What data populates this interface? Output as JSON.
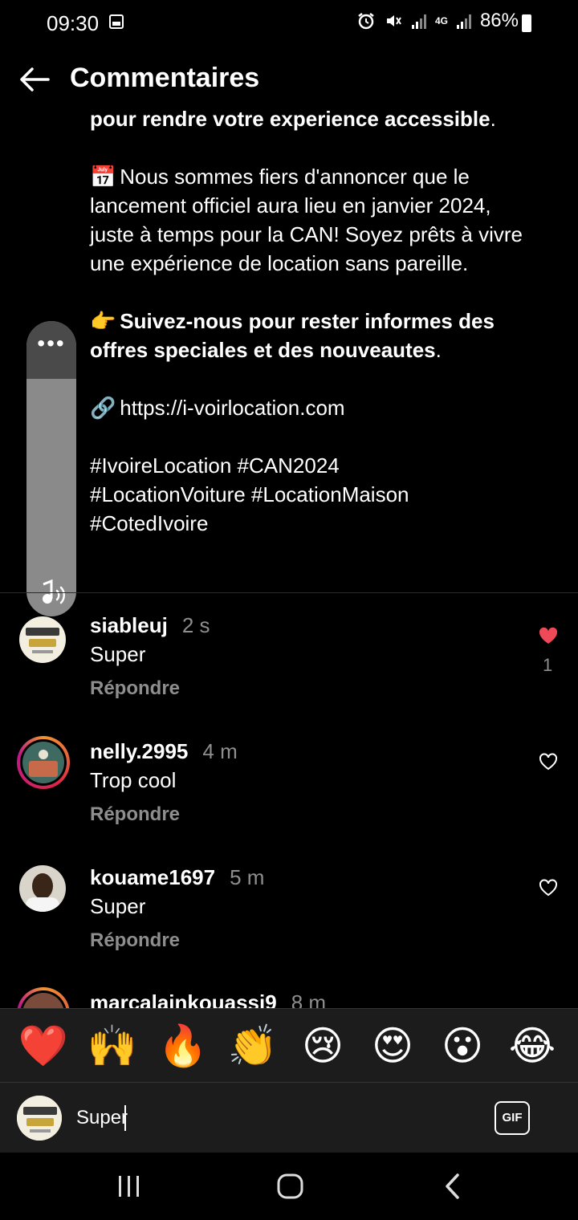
{
  "status_bar": {
    "time": "09:30",
    "network": "4G",
    "battery": "86%"
  },
  "header": {
    "title": "Commentaires"
  },
  "caption": {
    "line_bold_1": "pour rendre votre experience accessible",
    "line_bold_1_tail": ".",
    "para2": "Nous sommes fiers d'annoncer que le lancement officiel aura lieu en janvier 2024, juste à temps pour la CAN! Soyez prêts à vivre une expérience de location sans pareille.",
    "calendar_emoji": "📅",
    "pointing_emoji": "👉",
    "para3_bold": "Suivez-nous pour rester informes des offres speciales et des nouveautes",
    "para3_tail": ".",
    "link_emoji": "🔗",
    "link": "https://i-voirlocation.com",
    "hashtags_1": "#IvoireLocation #CAN2024",
    "hashtags_2": "#LocationVoiture #LocationMaison",
    "hashtags_3": "#CotedIvoire"
  },
  "audio_control": {
    "dots": "•••"
  },
  "comments": [
    {
      "username": "siableuj",
      "time": "2 s",
      "text": "Super",
      "reply": "Répondre",
      "liked": true,
      "likes": "1"
    },
    {
      "username": "nelly.2995",
      "time": "4 m",
      "text": "Trop cool",
      "reply": "Répondre",
      "liked": false
    },
    {
      "username": "kouame1697",
      "time": "5 m",
      "text": "Super",
      "reply": "Répondre",
      "liked": false
    },
    {
      "username": "marcalainkouassi9",
      "time": "8 m"
    }
  ],
  "emoji_bar": [
    "❤️",
    "🙌",
    "🔥",
    "👏",
    "😢",
    "😍",
    "😮",
    "😂"
  ],
  "input": {
    "value": "Super",
    "gif_label": "GIF"
  },
  "colors": {
    "background": "#000000",
    "secondary_text": "#8e8e8e",
    "heart_red": "#ed4956",
    "bar": "#1c1c1c"
  }
}
